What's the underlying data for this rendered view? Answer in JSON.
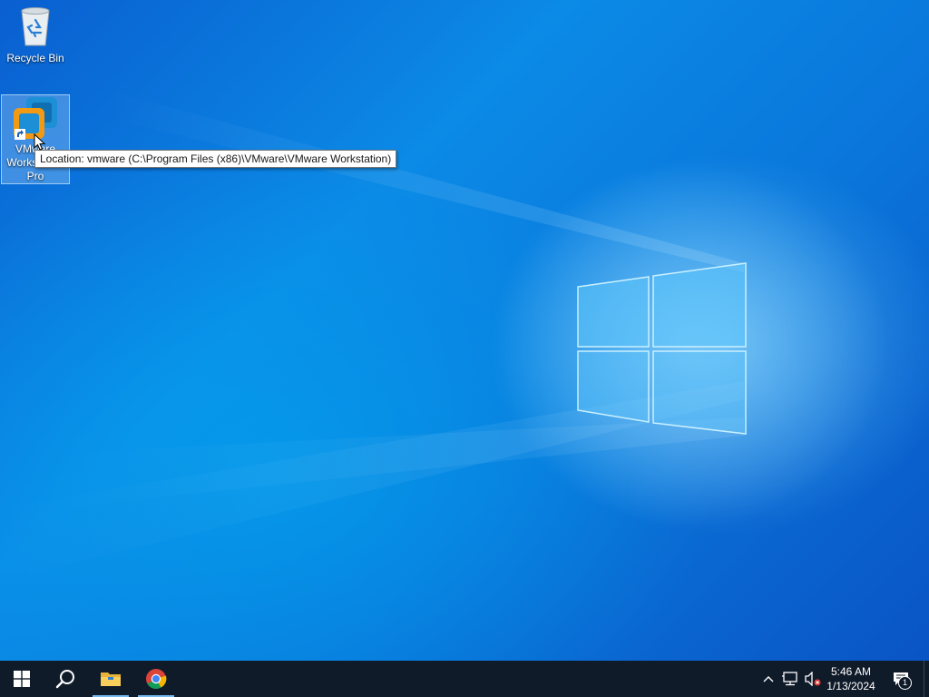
{
  "desktop": {
    "icons": [
      {
        "label": "Recycle Bin"
      },
      {
        "label_line1": "VMware",
        "label_line2": "Workstation",
        "label_line3": "Pro"
      }
    ],
    "tooltip": "Location: vmware (C:\\Program Files (x86)\\VMware\\VMware Workstation)"
  },
  "taskbar": {
    "pinned": [
      "start-icon",
      "search-icon",
      "file-explorer-icon",
      "chrome-icon"
    ],
    "tray": {
      "time": "5:46 AM",
      "date": "1/13/2024",
      "notification_count": "1"
    }
  },
  "colors": {
    "wallpaper": "#0b78dc",
    "taskbar": "#101b2a",
    "accent": "#76b9ed"
  }
}
